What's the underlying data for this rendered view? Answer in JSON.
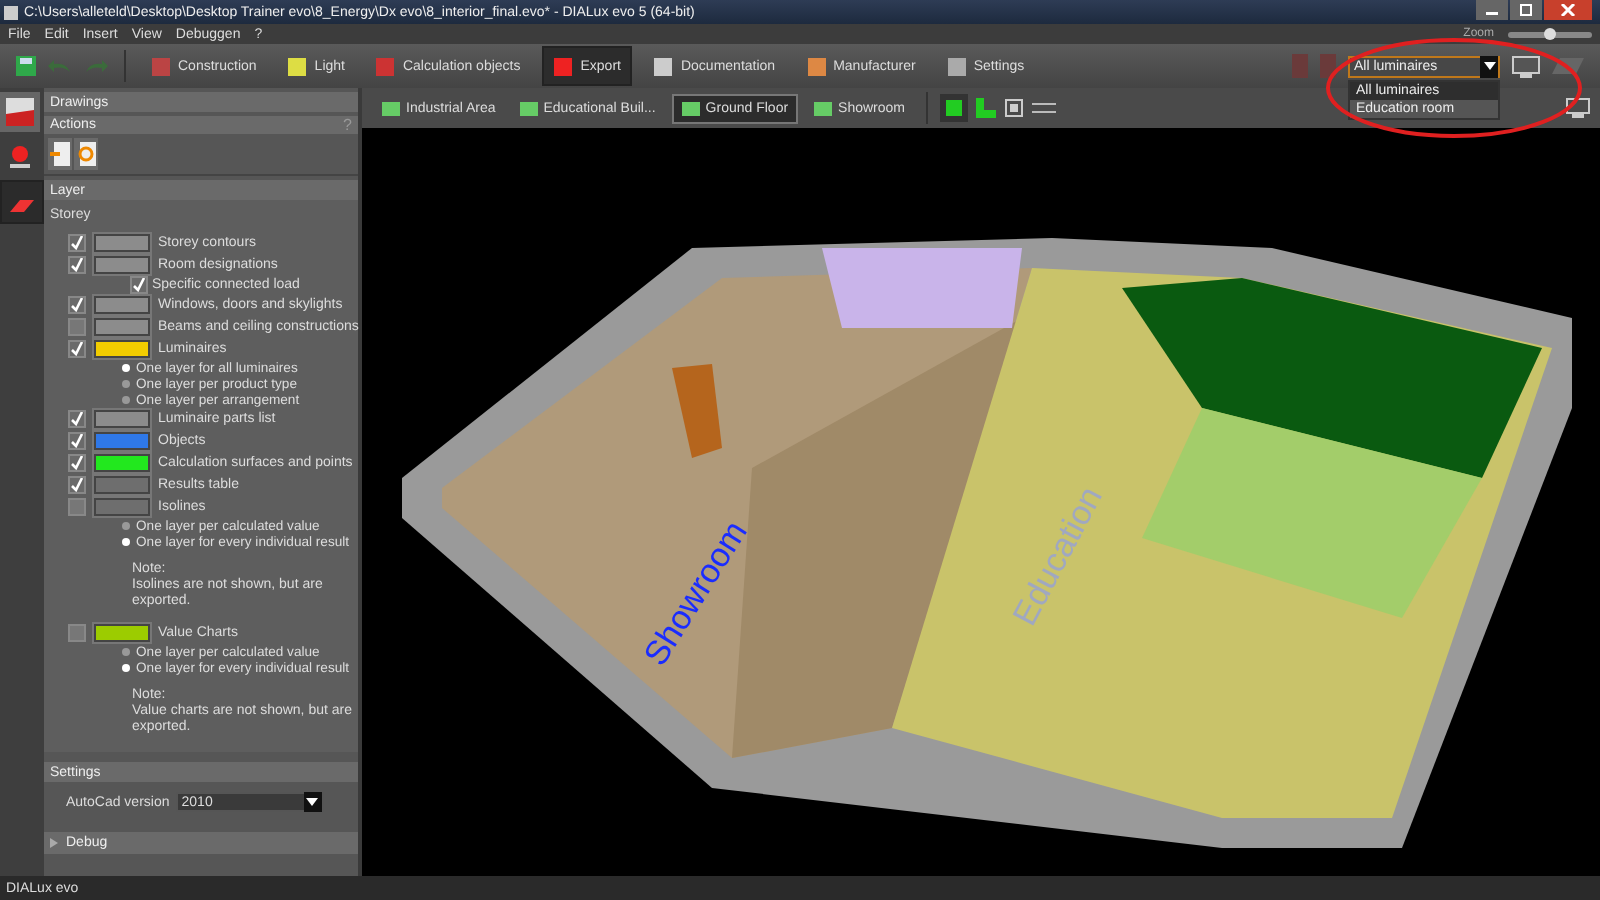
{
  "window": {
    "title": "C:\\Users\\alleteld\\Desktop\\Desktop Trainer evo\\8_Energy\\Dx evo\\8_interior_final.evo* - DIALux evo 5  (64-bit)"
  },
  "menu": [
    "File",
    "Edit",
    "Insert",
    "View",
    "Debuggen",
    "?"
  ],
  "modes": [
    {
      "label": "Construction",
      "selected": false
    },
    {
      "label": "Light",
      "selected": false
    },
    {
      "label": "Calculation objects",
      "selected": false
    },
    {
      "label": "Export",
      "selected": true
    },
    {
      "label": "Documentation",
      "selected": false
    },
    {
      "label": "Manufacturer",
      "selected": false
    },
    {
      "label": "Settings",
      "selected": false
    }
  ],
  "zoom": {
    "label": "Zoom",
    "level": 0.5
  },
  "luminaire_filter": {
    "value": "All luminaires",
    "options": [
      {
        "label": "All luminaires",
        "selected": true
      },
      {
        "label": "Education room",
        "selected": false
      }
    ]
  },
  "view_tabs": [
    {
      "label": "Industrial Area",
      "selected": false
    },
    {
      "label": "Educational Buil...",
      "selected": false
    },
    {
      "label": "Ground Floor",
      "selected": true
    },
    {
      "label": "Showroom",
      "selected": false
    }
  ],
  "panel": {
    "drawings": "Drawings",
    "actions": "Actions",
    "help": "?",
    "layer": "Layer",
    "storey": "Storey",
    "rows": [
      {
        "kind": "layer",
        "label": "Storey contours",
        "checked": true,
        "color": "#8c8c8c"
      },
      {
        "kind": "layer",
        "label": "Room designations",
        "checked": true,
        "color": "#8c8c8c"
      },
      {
        "kind": "sub",
        "label": "Specific connected load",
        "checked": true
      },
      {
        "kind": "layer",
        "label": "Windows, doors and skylights",
        "checked": true,
        "color": "#8c8c8c"
      },
      {
        "kind": "layer",
        "label": "Beams and ceiling constructions",
        "checked": false,
        "color": "#8c8c8c"
      },
      {
        "kind": "layer",
        "label": "Luminaires",
        "checked": true,
        "color": "#f2cc00"
      },
      {
        "kind": "option",
        "label": "One layer for all luminaires",
        "selected": true
      },
      {
        "kind": "option",
        "label": "One layer per product type",
        "selected": false
      },
      {
        "kind": "option",
        "label": "One layer per arrangement",
        "selected": false
      },
      {
        "kind": "layer",
        "label": "Luminaire parts list",
        "checked": true,
        "color": "#8c8c8c"
      },
      {
        "kind": "layer",
        "label": "Objects",
        "checked": true,
        "color": "#2f78e8"
      },
      {
        "kind": "layer",
        "label": "Calculation surfaces and points",
        "checked": true,
        "color": "#22e81e"
      },
      {
        "kind": "layer",
        "label": "Results table",
        "checked": true,
        "color": "#6e6e6e"
      },
      {
        "kind": "layer",
        "label": "Isolines",
        "checked": false,
        "color": "#6e6e6e"
      },
      {
        "kind": "option",
        "label": "One layer per calculated value",
        "selected": false
      },
      {
        "kind": "option",
        "label": "One layer for every individual result",
        "selected": true
      },
      {
        "kind": "note",
        "label": "Note:",
        "text": "Isolines are not shown, but are exported."
      },
      {
        "kind": "layer",
        "label": "Value Charts",
        "checked": false,
        "color": "#9ccc00"
      },
      {
        "kind": "option",
        "label": "One layer per calculated value",
        "selected": false
      },
      {
        "kind": "option",
        "label": "One layer for every individual result",
        "selected": true
      },
      {
        "kind": "note",
        "label": "Note:",
        "text": "Value charts are not shown, but are exported."
      }
    ],
    "settings": "Settings",
    "autocad_label": "AutoCad version",
    "autocad_value": "2010",
    "debug": "Debug"
  },
  "scene_labels": [
    "Showroom",
    "Education"
  ],
  "status_bar": {
    "logo": "DIALux evo"
  }
}
